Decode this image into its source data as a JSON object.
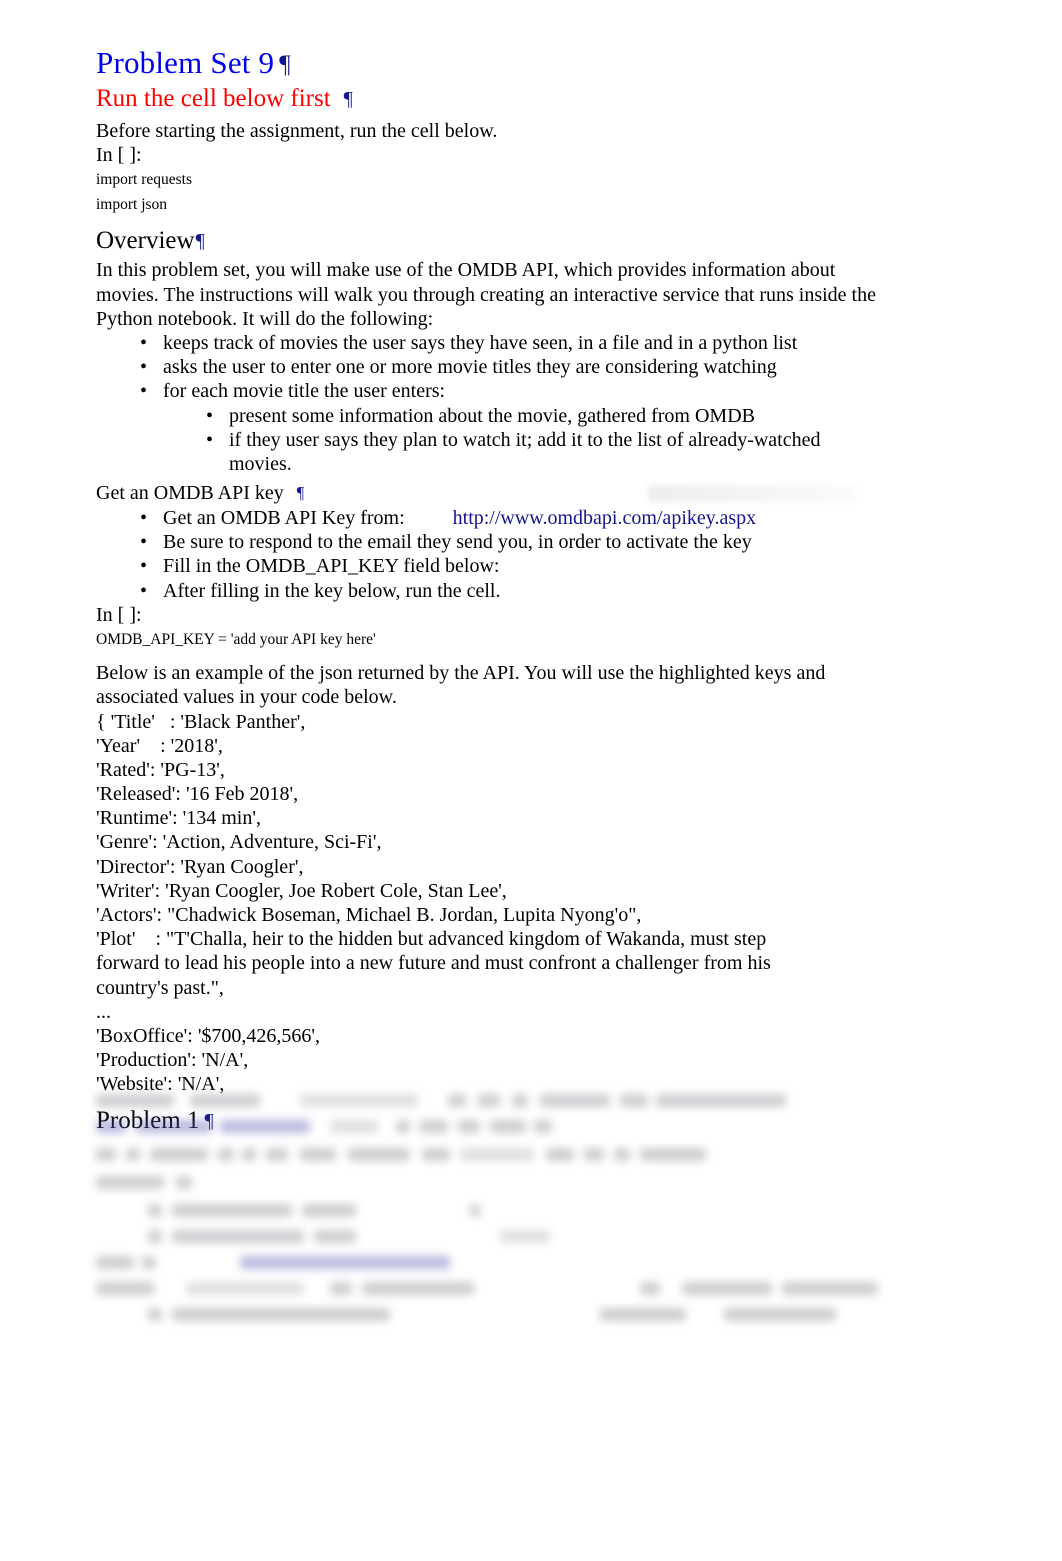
{
  "document": {
    "title": "Problem Set 9",
    "pilcrow": "¶"
  },
  "sections": {
    "run_first": {
      "heading": "Run the cell below first",
      "intro": "Before starting the assignment, run the cell below.",
      "prompt": "In [ ]:",
      "code": [
        "import requests",
        "import json"
      ]
    },
    "overview": {
      "heading": "Overview",
      "paragraph": "In this problem set, you will make use of the OMDB API, which provides information about movies. The instructions will walk you through creating an interactive service that runs inside the Python notebook. It will do the following:",
      "bullets": [
        "keeps track of movies the user says they have seen, in a file and in a python list",
        "asks the user to enter one or more movie titles they are considering watching",
        "for each movie title the user enters:"
      ],
      "sub_bullets": [
        "present some information about the movie, gathered from OMDB",
        "if they user says they plan to watch it; add it to the list of already-watched movies."
      ]
    },
    "api_key": {
      "heading": "Get an OMDB API key",
      "bullet_1_prefix": "Get an OMDB API Key from:",
      "bullet_1_link": "http://www.omdbapi.com/apikey.aspx",
      "bullets": [
        "Be sure to respond to the email they send you, in order to activate the key",
        "Fill in the OMDB_API_KEY field below:",
        "After filling in the key below, run the cell."
      ],
      "prompt": "In [ ]:",
      "code": [
        "OMDB_API_KEY = 'add your API key here'"
      ]
    },
    "json_example": {
      "paragraph": "Below is an example of the json returned by the API. You will use the highlighted keys and associated values in your code below.",
      "lines": [
        "{ 'Title'   : 'Black Panther',",
        "'Year'    : '2018',",
        "'Rated': 'PG-13',",
        "'Released': '16 Feb 2018',",
        "'Runtime': '134 min',",
        "'Genre': 'Action, Adventure, Sci-Fi',",
        "'Director': 'Ryan Coogler',",
        "'Writer': 'Ryan Coogler, Joe Robert Cole, Stan Lee',",
        "'Actors': \"Chadwick Boseman, Michael B. Jordan, Lupita Nyong'o\",",
        "'Plot'    : \"T'Challa, heir to the hidden but advanced kingdom of Wakanda, must step",
        "forward to lead his people into a new future and must confront a challenger from his",
        "country's past.\",",
        "...",
        "'BoxOffice': '$700,426,566',",
        "'Production': 'N/A',",
        "'Website': 'N/A',"
      ]
    },
    "problem_1": {
      "heading": "Problem 1"
    }
  },
  "colors": {
    "title_blue": "#0000ee",
    "alert_red": "#ff0000",
    "link_navy": "#14148c",
    "pilcrow_navy": "#14148c",
    "text_black": "#000000",
    "page_background": "#ffffff"
  }
}
